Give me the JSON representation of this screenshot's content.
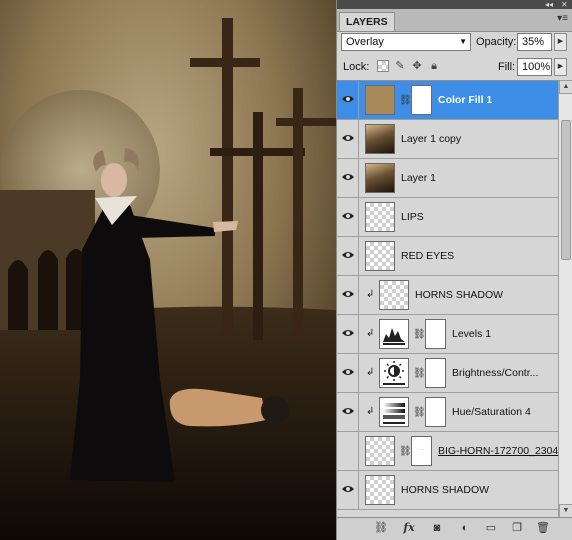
{
  "panel": {
    "title": "LAYERS",
    "collapse_glyph": "◂◂",
    "close_glyph": "✕",
    "menu_glyph": "▾≡",
    "blend_mode": "Overlay",
    "opacity_label": "Opacity:",
    "opacity_value": "35%",
    "lock_label": "Lock:",
    "fill_label": "Fill:",
    "fill_value": "100%"
  },
  "layers": [
    {
      "name": "Color Fill 1",
      "visible": true,
      "selected": true,
      "thumb": "color-fill",
      "thumb_color": "#a7895a",
      "has_mask": true,
      "clipped": false
    },
    {
      "name": "Layer 1 copy",
      "visible": true,
      "selected": false,
      "thumb": "photo",
      "has_mask": false,
      "clipped": false
    },
    {
      "name": "Layer 1",
      "visible": true,
      "selected": false,
      "thumb": "photo",
      "has_mask": false,
      "clipped": false
    },
    {
      "name": "LIPS",
      "visible": true,
      "selected": false,
      "thumb": "transparent",
      "has_mask": false,
      "clipped": false
    },
    {
      "name": "RED EYES",
      "visible": true,
      "selected": false,
      "thumb": "transparent",
      "has_mask": false,
      "clipped": false
    },
    {
      "name": "HORNS SHADOW",
      "visible": true,
      "selected": false,
      "thumb": "transparent",
      "has_mask": false,
      "clipped": true
    },
    {
      "name": "Levels 1",
      "visible": true,
      "selected": false,
      "thumb": "levels-adjustment",
      "has_mask": true,
      "clipped": true
    },
    {
      "name": "Brightness/Contr...",
      "visible": true,
      "selected": false,
      "thumb": "brightness-adjustment",
      "has_mask": true,
      "clipped": true
    },
    {
      "name": "Hue/Saturation 4",
      "visible": true,
      "selected": false,
      "thumb": "hue-saturation-adjustment",
      "has_mask": true,
      "clipped": true
    },
    {
      "name": "BIG-HORN-172700_2304",
      "visible": false,
      "selected": false,
      "thumb": "transparent",
      "has_mask": true,
      "clipped": false
    },
    {
      "name": "HORNS SHADOW",
      "visible": true,
      "selected": false,
      "thumb": "transparent",
      "has_mask": false,
      "clipped": false
    }
  ],
  "bottom_icons": [
    "link-icon",
    "fx-icon",
    "mask-icon",
    "adjustment-icon",
    "folder-icon",
    "new-layer-icon",
    "trash-icon"
  ],
  "colors": {
    "selection": "#3d8ee6",
    "panel": "#d6d6d6",
    "fill_swatch": "#a7895a"
  }
}
